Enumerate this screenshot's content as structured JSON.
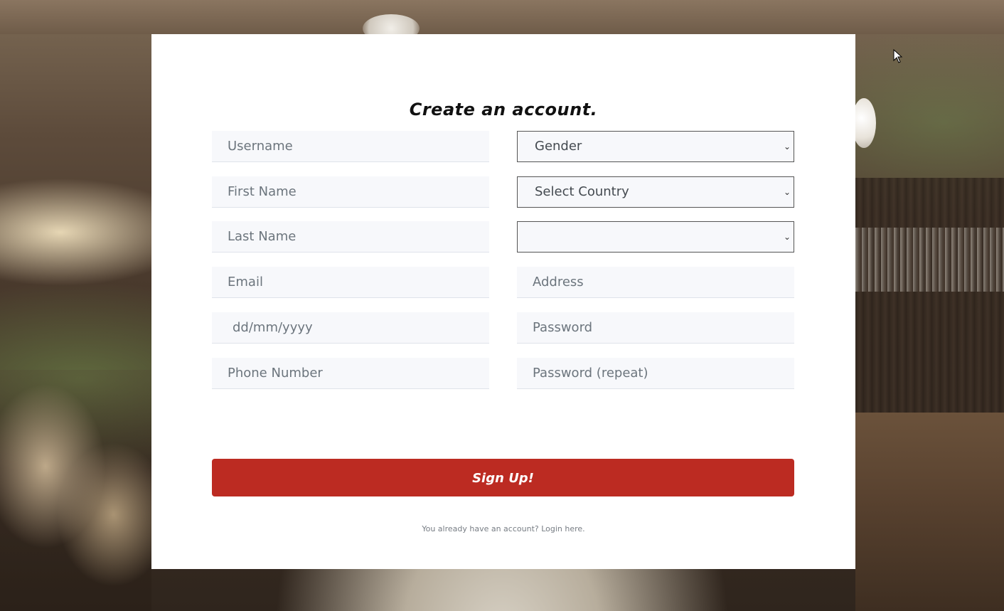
{
  "form": {
    "title": "Create an account.",
    "left_fields": [
      {
        "placeholder": "Username",
        "value": ""
      },
      {
        "placeholder": "First Name",
        "value": ""
      },
      {
        "placeholder": "Last Name",
        "value": ""
      },
      {
        "placeholder": "Email",
        "value": ""
      },
      {
        "placeholder": "dd/mm/yyyy",
        "value": ""
      },
      {
        "placeholder": "Phone Number",
        "value": ""
      }
    ],
    "selects": {
      "gender": "Gender",
      "country": "Select Country",
      "region": ""
    },
    "right_fields": {
      "address": "Address",
      "password": "Password",
      "password_repeat": "Password (repeat)"
    },
    "submit_label": "Sign Up!",
    "login_prompt": "You already have an account? Login here.",
    "accent_color": "#bc2b22"
  },
  "icons": {
    "select_chevron": "chevron-down-icon",
    "cursor": "mouse-pointer-icon"
  }
}
